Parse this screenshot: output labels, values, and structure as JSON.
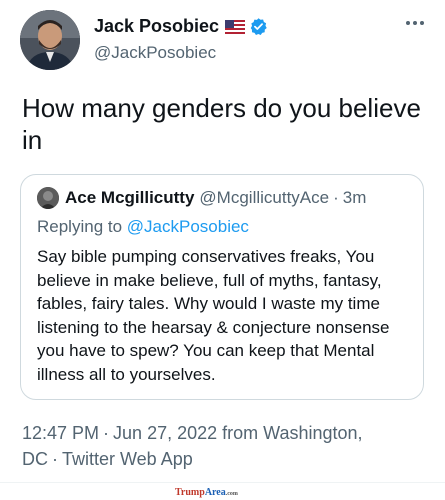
{
  "author": {
    "display_name": "Jack Posobiec",
    "handle": "@JackPosobiec"
  },
  "tweet": {
    "text": "How many genders do you believe in"
  },
  "quoted_tweet": {
    "display_name": "Ace Mcgillicutty",
    "handle": "@McgillicuttyAce",
    "dot": "·",
    "time": "3m",
    "replying_to_prefix": "Replying to ",
    "replying_to_handle": "@JackPosobiec",
    "text": "Say bible pumping conservatives freaks, You believe in make believe, full of myths, fantasy, fables, fairy tales. Why would I waste my time listening to the hearsay & conjecture nonsense you have to spew? You can keep that Mental illness all to yourselves."
  },
  "meta": {
    "time": "12:47 PM",
    "date": "Jun 27, 2022 from Washington,",
    "location_cont": "DC",
    "source": "Twitter Web App",
    "sep": "·"
  },
  "watermark": {
    "brand": "Trump",
    "brand2": "Area",
    "suffix": ".com"
  },
  "icons": {
    "flag": "us-flag-icon",
    "verified": "verified-badge-icon",
    "more": "more-options-icon"
  },
  "colors": {
    "link": "#1d9bf0",
    "secondary_text": "#536471",
    "border": "#cfd9de"
  }
}
